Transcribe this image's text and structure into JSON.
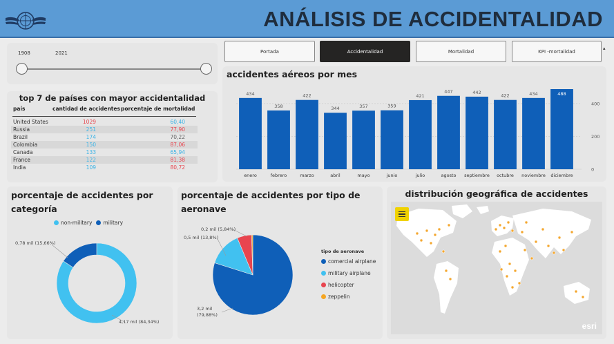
{
  "header": {
    "title": "ANÁLISIS DE ACCIDENTALIDAD"
  },
  "slider": {
    "start_year": "1908",
    "end_year": "2021"
  },
  "nav": {
    "tabs": [
      {
        "label": "Portada",
        "active": false
      },
      {
        "label": "Accidentalidad",
        "active": true
      },
      {
        "label": "Mortalidad",
        "active": false
      },
      {
        "label": "KPI -mortalidad",
        "active": false
      }
    ]
  },
  "table": {
    "title": "top 7 de países con mayor accidentalidad",
    "headers": [
      "país",
      "cantidad de accidentes",
      "porcentaje de mortalidad"
    ],
    "rows": [
      {
        "country": "United States",
        "count": "1029",
        "rate": "60,40",
        "count_color": "#e8454f",
        "rate_color": "#3bb3e6"
      },
      {
        "country": "Russia",
        "count": "251",
        "rate": "77,90",
        "count_color": "#3bb3e6",
        "rate_color": "#e8454f"
      },
      {
        "country": "Brazil",
        "count": "174",
        "rate": "70,22",
        "count_color": "#3bb3e6",
        "rate_color": "#666666"
      },
      {
        "country": "Colombia",
        "count": "150",
        "rate": "87,06",
        "count_color": "#3bb3e6",
        "rate_color": "#e8454f"
      },
      {
        "country": "Canada",
        "count": "133",
        "rate": "65,94",
        "count_color": "#3bb3e6",
        "rate_color": "#3bb3e6"
      },
      {
        "country": "France",
        "count": "122",
        "rate": "81,38",
        "count_color": "#3bb3e6",
        "rate_color": "#e8454f"
      },
      {
        "country": "India",
        "count": "109",
        "rate": "80,72",
        "count_color": "#3bb3e6",
        "rate_color": "#e8454f"
      }
    ]
  },
  "chart_data": [
    {
      "type": "bar",
      "title": "accidentes aéreos por mes",
      "categories": [
        "enero",
        "febrero",
        "marzo",
        "abril",
        "mayo",
        "junio",
        "julio",
        "agosto",
        "septiembre",
        "octubre",
        "noviembre",
        "diciembre"
      ],
      "values": [
        434,
        358,
        422,
        344,
        357,
        359,
        421,
        447,
        442,
        422,
        434,
        488
      ],
      "ylim": [
        0,
        488
      ],
      "yticks": [
        0,
        200,
        400
      ],
      "color": "#0f5fb8"
    },
    {
      "type": "pie",
      "title": "porcentaje de accidentes por categoría",
      "legend": "top",
      "donut": true,
      "slices": [
        {
          "name": "non-military",
          "value": 84.34,
          "label": "4,17 mil (84,34%)",
          "color": "#41c1f0"
        },
        {
          "name": "military",
          "value": 15.66,
          "label": "0,78 mil (15,66%)",
          "color": "#0f5fb8"
        }
      ]
    },
    {
      "type": "pie",
      "title": "porcentaje de accidentes por tipo de aeronave",
      "legend": "right",
      "legend_title": "tipo de aeronave",
      "slices": [
        {
          "name": "comercial airplane",
          "value": 79.88,
          "label": "3,2 mil (79,88%)",
          "color": "#0f5fb8"
        },
        {
          "name": "military airplane",
          "value": 13.8,
          "label": "0,5 mil (13,8%)",
          "color": "#41c1f0"
        },
        {
          "name": "helicopter",
          "value": 5.84,
          "label": "0,2 mil (5,84%)",
          "color": "#e8454f"
        },
        {
          "name": "zeppelin",
          "value": 0.48,
          "label": "",
          "color": "#f5a623"
        }
      ]
    }
  ],
  "map": {
    "title": "distribución geográfica de accidentes",
    "attribution": "esri"
  }
}
